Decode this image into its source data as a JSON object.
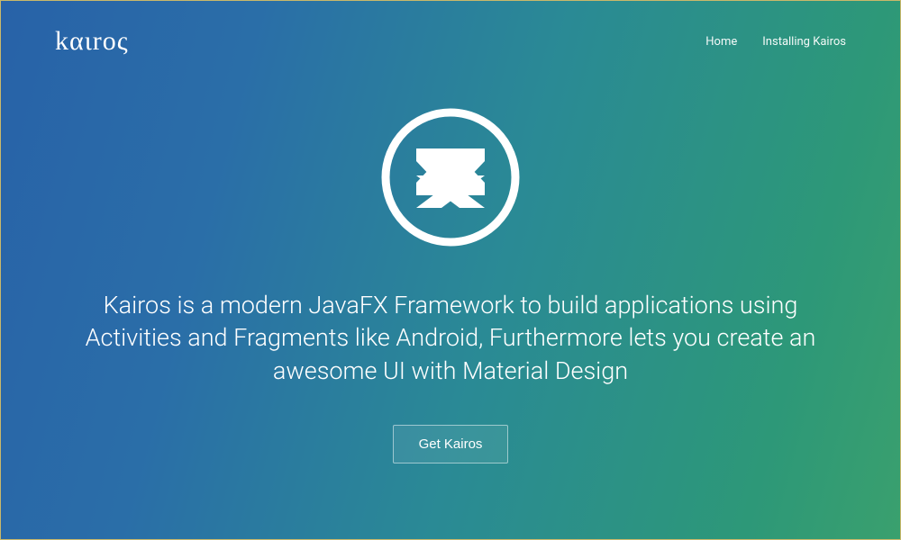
{
  "header": {
    "brand": "kαιroς",
    "nav": {
      "home": "Home",
      "install": "Installing Kairos"
    }
  },
  "hero": {
    "tagline": "Kairos is a modern JavaFX Framework to build applications using Activities and Fragments like Android, Furthermore lets you create an awesome UI with Material Design",
    "cta_label": "Get Kairos"
  }
}
